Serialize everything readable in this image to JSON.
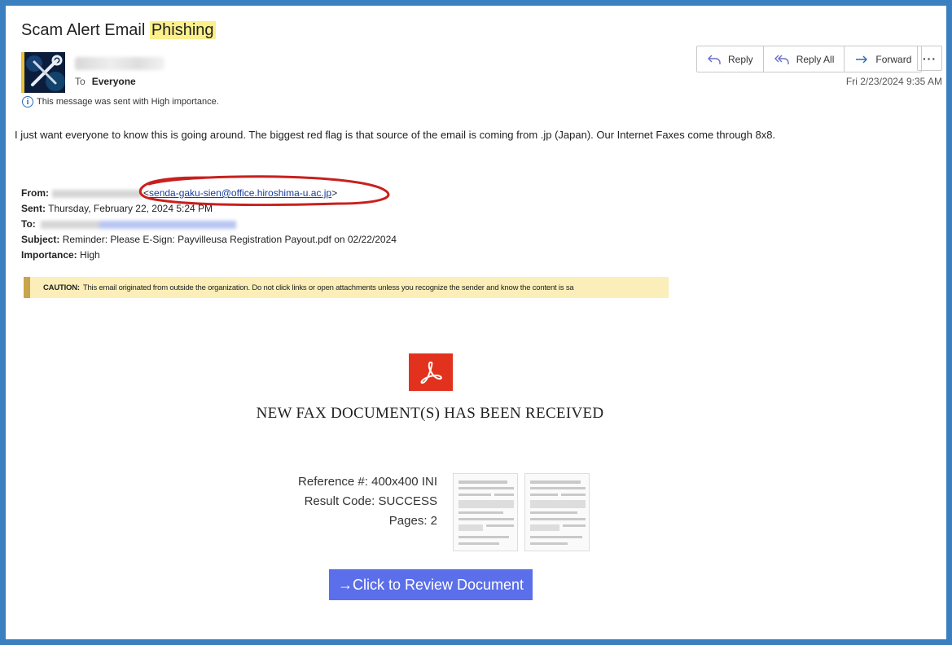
{
  "header": {
    "title_prefix": "Scam Alert Email",
    "title_highlight": "Phishing"
  },
  "sender": {
    "to_label": "To",
    "to_value": "Everyone",
    "importance_note": "This message was sent with High importance.",
    "date": "Fri 2/23/2024 9:35 AM"
  },
  "toolbar": {
    "reply": "Reply",
    "reply_all": "Reply All",
    "forward": "Forward",
    "more": "···"
  },
  "message": {
    "body": "I just want everyone to know this is going around. The biggest red flag is that source of the email is coming from .jp (Japan). Our Internet Faxes come through 8x8."
  },
  "forwarded": {
    "from_label": "From:",
    "from_email": "senda-gaku-sien@office.hiroshima-u.ac.jp",
    "sent_label": "Sent:",
    "sent_value": "Thursday, February 22, 2024 5:24 PM",
    "to_label": "To:",
    "subject_label": "Subject:",
    "subject_value": "Reminder: Please E-Sign: Payvilleusa Registration Payout.pdf on 02/22/2024",
    "importance_label": "Importance:",
    "importance_value": "High"
  },
  "caution": {
    "label": "CAUTION:",
    "text": "This email originated from outside the organization. Do not click links or open attachments unless you recognize the sender and know the content is sa"
  },
  "fax": {
    "heading": "NEW FAX DOCUMENT(S) HAS BEEN RECEIVED",
    "reference": "Reference #: 400x400 INI",
    "result_code": "Result Code: SUCCESS",
    "pages": "Pages: 2",
    "button": "→Click to Review Document"
  },
  "colors": {
    "frame": "#3a7fbf",
    "highlight": "#fbf089",
    "caution_bg": "#fbeeb8",
    "pdf_red": "#e2321d",
    "button_blue": "#5b6fea",
    "annotation_red": "#c8201e"
  },
  "icons": [
    "info-icon",
    "reply-icon",
    "reply-all-icon",
    "forward-icon",
    "more-icon",
    "pdf-icon"
  ]
}
